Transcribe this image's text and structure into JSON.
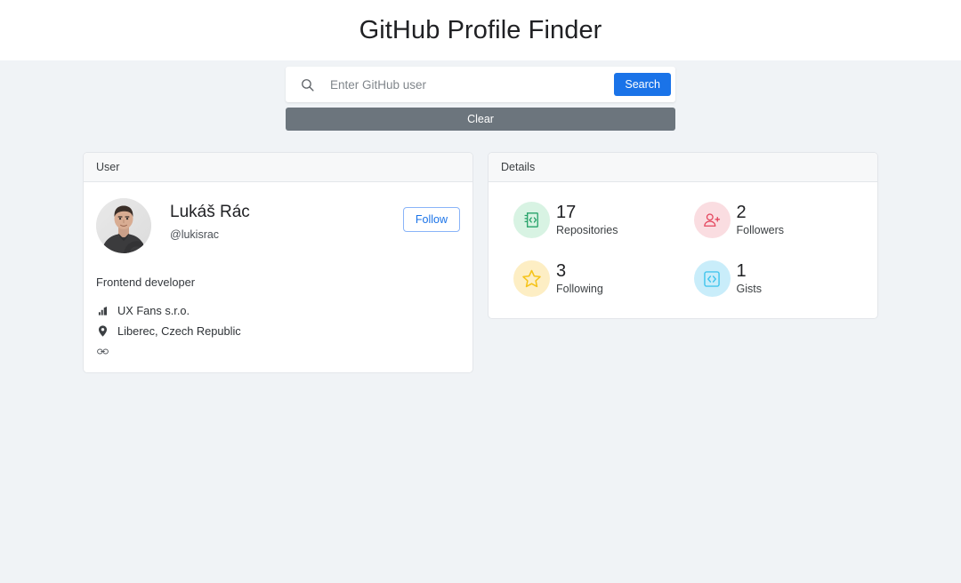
{
  "header": {
    "title": "GitHub Profile Finder"
  },
  "search": {
    "icon": "search-icon",
    "placeholder": "Enter GitHub user",
    "value": "",
    "search_label": "Search",
    "clear_label": "Clear",
    "accent_color": "#1a73e8",
    "clear_color": "#6c757d"
  },
  "user_card": {
    "header": "User",
    "avatar_alt": "avatar",
    "full_name": "Lukáš Rác",
    "handle": "@lukisrac",
    "follow_label": "Follow",
    "bio": "Frontend developer",
    "meta": [
      {
        "icon": "company-icon",
        "text": "UX Fans s.r.o."
      },
      {
        "icon": "location-pin-icon",
        "text": "Liberec, Czech Republic"
      },
      {
        "icon": "link-icon",
        "text": ""
      }
    ]
  },
  "details_card": {
    "header": "Details",
    "stats": [
      {
        "icon": "repositories-icon",
        "value": "17",
        "label": "Repositories",
        "bubble_color": "#d8f3e3",
        "icon_color": "#26a269"
      },
      {
        "icon": "followers-icon",
        "value": "2",
        "label": "Followers",
        "bubble_color": "#fadde1",
        "icon_color": "#e4445c"
      },
      {
        "icon": "following-star-icon",
        "value": "3",
        "label": "Following",
        "bubble_color": "#fdeec4",
        "icon_color": "#f5c318"
      },
      {
        "icon": "gists-icon",
        "value": "1",
        "label": "Gists",
        "bubble_color": "#c9edfa",
        "icon_color": "#45c6ed"
      }
    ]
  },
  "theme": {
    "page_background": "#f0f3f6",
    "card_background": "#ffffff",
    "card_border": "#e3e6ea"
  }
}
